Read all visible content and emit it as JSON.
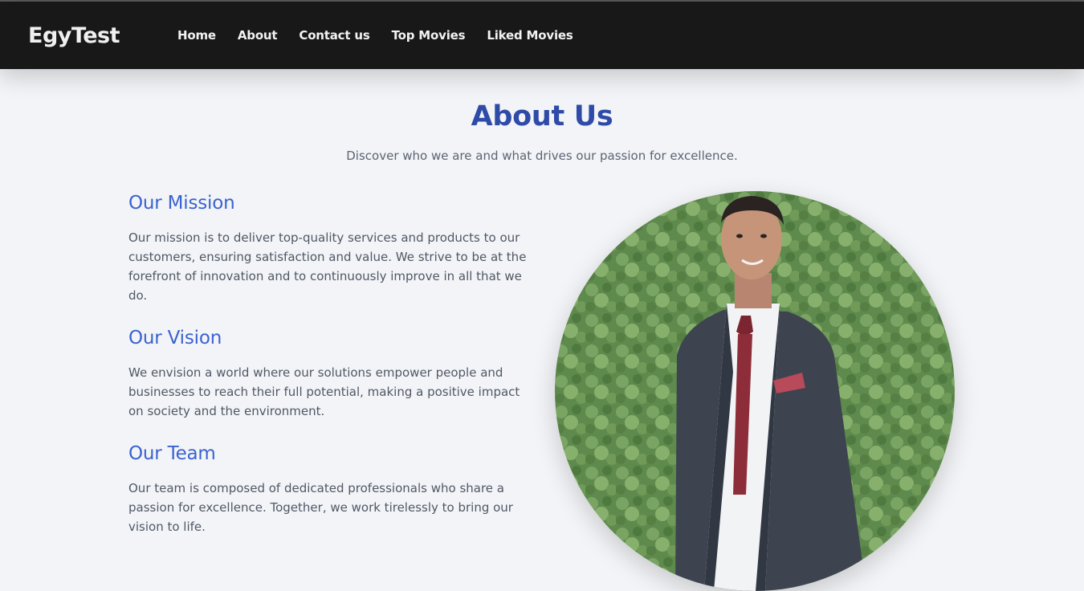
{
  "brand": "EgyTest",
  "nav": {
    "items": [
      "Home",
      "About",
      "Contact us",
      "Top Movies",
      "Liked Movies"
    ]
  },
  "header": {
    "title": "About Us",
    "subtitle": "Discover who we are and what drives our passion for excellence."
  },
  "sections": [
    {
      "title": "Our Mission",
      "text": "Our mission is to deliver top-quality services and products to our customers, ensuring satisfaction and value. We strive to be at the forefront of innovation and to continuously improve in all that we do."
    },
    {
      "title": "Our Vision",
      "text": "We envision a world where our solutions empower people and businesses to reach their full potential, making a positive impact on society and the environment."
    },
    {
      "title": "Our Team",
      "text": "Our team is composed of dedicated professionals who share a passion for excellence. Together, we work tirelessly to bring our vision to life."
    }
  ],
  "colors": {
    "navbar": "#181818",
    "page_background": "#f3f4f7",
    "title": "#2f4ba8",
    "section_title": "#3a63d0"
  },
  "icons": {
    "photo": "team-member-photo"
  }
}
